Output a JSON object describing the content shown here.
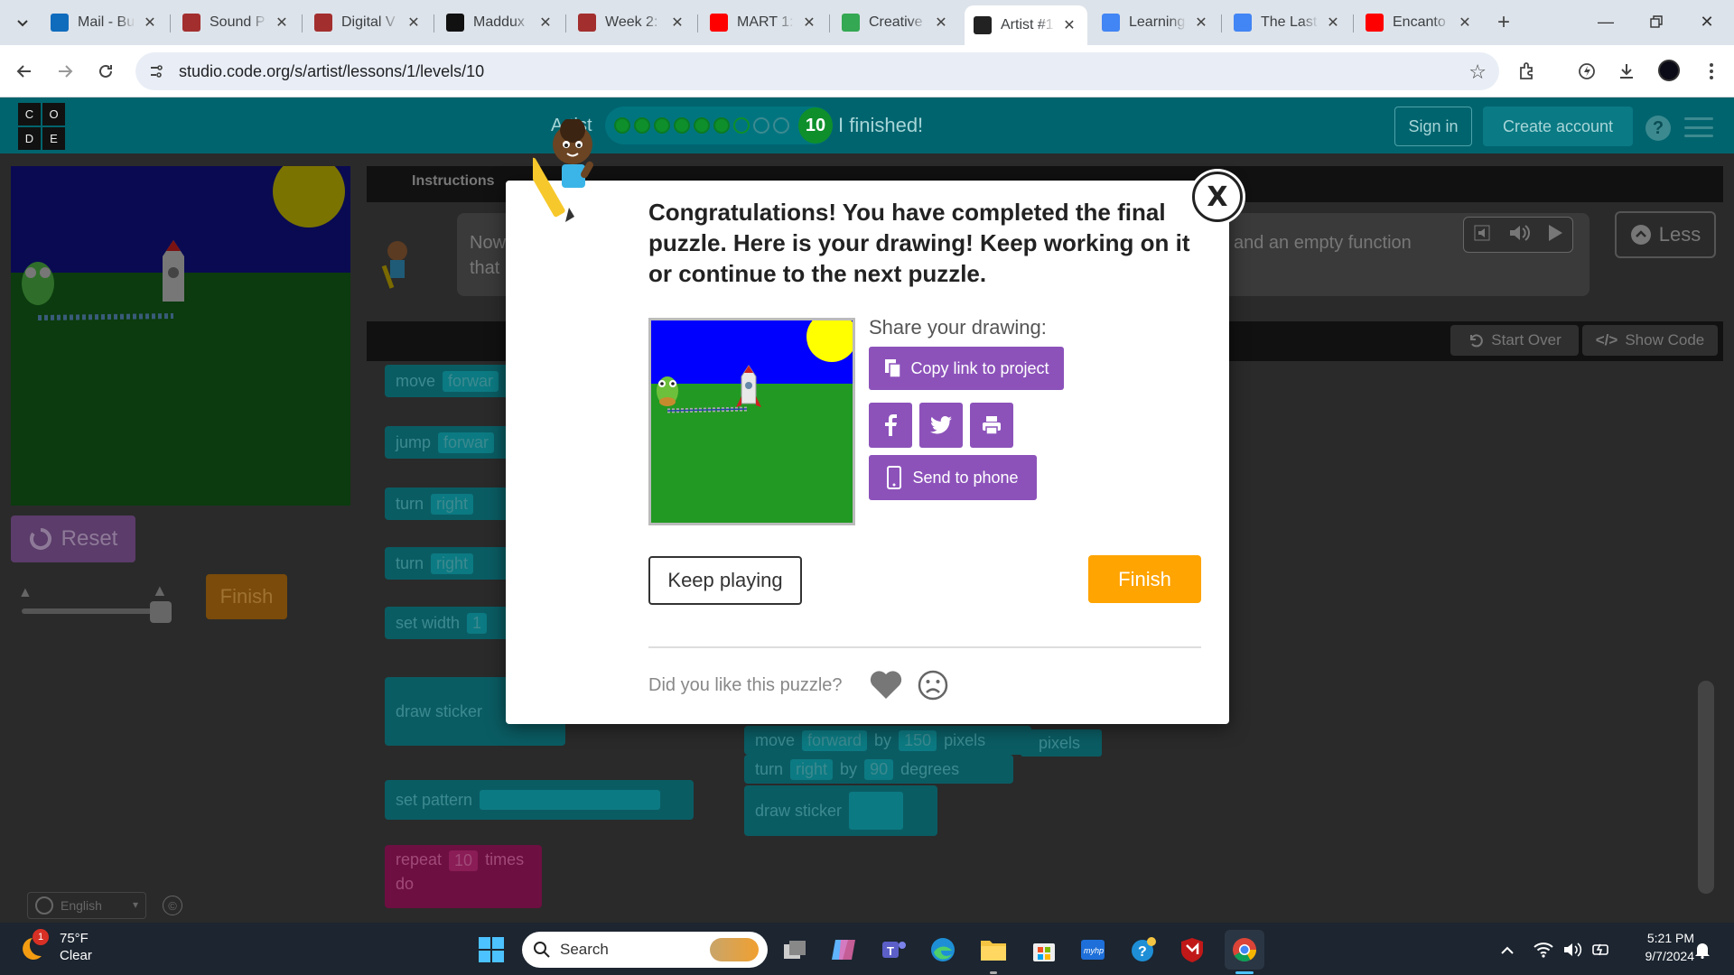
{
  "browser": {
    "tabs": [
      {
        "title": "Mail - Bu",
        "icon": "outlook-icon",
        "color": "#0f6cbd"
      },
      {
        "title": "Sound P",
        "icon": "canvas-icon",
        "color": "#a32e2e"
      },
      {
        "title": "Digital V",
        "icon": "canvas-icon",
        "color": "#a32e2e"
      },
      {
        "title": "Maddux",
        "icon": "github-icon",
        "color": "#111111"
      },
      {
        "title": "Week 2:",
        "icon": "canvas-icon",
        "color": "#a32e2e"
      },
      {
        "title": "MART 1:",
        "icon": "youtube-icon",
        "color": "#ff0000"
      },
      {
        "title": "Creative",
        "icon": "drive-icon",
        "color": "#34a853"
      },
      {
        "title": "Artist #1",
        "icon": "codeorg-icon",
        "color": "#222222",
        "active": true
      },
      {
        "title": "Learning",
        "icon": "docs-icon",
        "color": "#4285f4"
      },
      {
        "title": "The Last",
        "icon": "docs-icon",
        "color": "#4285f4"
      },
      {
        "title": "Encanto",
        "icon": "youtube-icon",
        "color": "#ff0000"
      }
    ],
    "url": "studio.code.org/s/artist/lessons/1/levels/10"
  },
  "header": {
    "title": "Artist",
    "level_number": "10",
    "finished_text": "I finished!",
    "sign_in": "Sign in",
    "create_account": "Create account",
    "help": "?"
  },
  "progress": {
    "completed": 6,
    "open": 1,
    "empty": 2
  },
  "left_panel": {
    "reset": "Reset",
    "finish": "Finish",
    "language": "English",
    "copyright": "©"
  },
  "instructions": {
    "tab": "Instructions",
    "line1_visible": "Now",
    "line2_visible": "that",
    "line1_right": "and an empty function",
    "less": "Less"
  },
  "workspace": {
    "start_over": "Start Over",
    "show_code": "Show Code"
  },
  "blocks": {
    "move": "move",
    "forward": "forwar",
    "jump": "jump",
    "jump_forward": "forwar",
    "turn": "turn",
    "right": "right",
    "set_width": "set width",
    "width_value": "1",
    "draw_sticker": "draw sticker",
    "set_pattern": "set pattern",
    "repeat": "repeat",
    "repeat_value": "10",
    "times": "times",
    "do": "do",
    "code_move": "move",
    "code_forward": "forward",
    "code_by": "by",
    "code_pixels_value": "150",
    "code_pixels": "pixels",
    "pixels_ghost": "pixels",
    "code_turn": "turn",
    "code_right": "right",
    "code_turn_by": "by",
    "code_degrees_value": "90",
    "code_degrees": "degrees",
    "code_draw_sticker": "draw sticker"
  },
  "modal": {
    "close": "X",
    "message": "Congratulations! You have completed the final puzzle. Here is your drawing! Keep working on it or continue to the next puzzle.",
    "share_label": "Share your drawing:",
    "copy_link": "Copy link to project",
    "send_to_phone": "Send to phone",
    "keep_playing": "Keep playing",
    "finish": "Finish",
    "feedback_question": "Did you like this puzzle?",
    "colors": {
      "purple": "#8c52ba",
      "orange": "#ffa400"
    }
  },
  "taskbar": {
    "temperature": "75°F",
    "condition": "Clear",
    "weather_badge": "1",
    "search_placeholder": "Search",
    "time": "5:21 PM",
    "date": "9/7/2024"
  }
}
